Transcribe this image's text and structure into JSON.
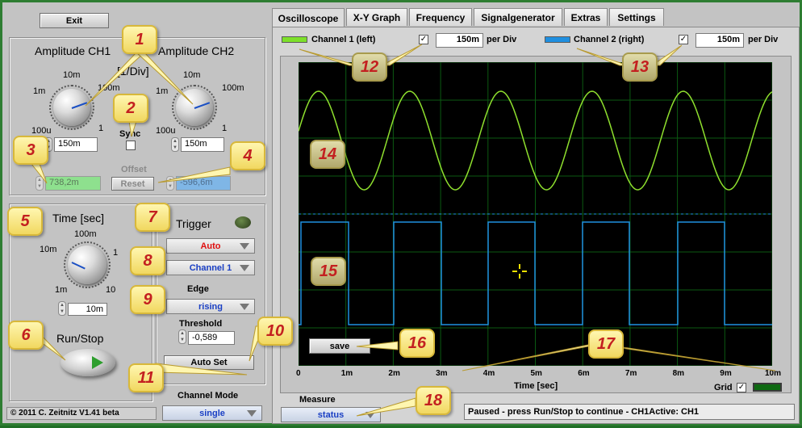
{
  "app": {
    "exit_label": "Exit",
    "copyright": "© 2011  C. Zeitnitz V1.41 beta"
  },
  "amplitude": {
    "ch1_title": "Amplitude CH1",
    "ch2_title": "Amplitude CH2",
    "unit": "[1/Div]",
    "knob_labels": {
      "a": "10m",
      "b": "100m",
      "c": "1m",
      "d": "1",
      "e": "100u"
    },
    "ch1_value": "150m",
    "ch2_value": "150m",
    "sync_label": "Sync",
    "offset_label": "Offset",
    "offset_ch1": "738,2m",
    "offset_ch2": "-596,6m",
    "reset_label": "Reset"
  },
  "time": {
    "title": "Time [sec]",
    "labels": {
      "top": "100m",
      "left_top": "10m",
      "right_top": "1",
      "left_bot": "1m",
      "right_bot": "10"
    },
    "value": "10m"
  },
  "runstop": {
    "label": "Run/Stop"
  },
  "trigger": {
    "title": "Trigger",
    "mode": "Auto",
    "channel": "Channel 1",
    "edge_label": "Edge",
    "edge": "rising",
    "threshold_label": "Threshold",
    "threshold": "-0,589",
    "autoset_label": "Auto Set"
  },
  "channel_mode": {
    "label": "Channel Mode",
    "value": "single"
  },
  "tabs": [
    "Oscilloscope",
    "X-Y Graph",
    "Frequency",
    "Signalgenerator",
    "Extras",
    "Settings"
  ],
  "scope": {
    "ch1_label": "Channel 1 (left)",
    "ch2_label": "Channel 2 (right)",
    "ch1_div": "150m",
    "ch2_div": "150m",
    "per_div": "per Div",
    "save_label": "save",
    "x_ticks": [
      "0",
      "1m",
      "2m",
      "3m",
      "4m",
      "5m",
      "6m",
      "7m",
      "8m",
      "9m",
      "10m"
    ],
    "x_label": "Time [sec]",
    "grid_label": "Grid",
    "colors": {
      "ch1": "#8fe02e",
      "ch2": "#1f8fe0",
      "grid": "#0b5a12",
      "screen": "#000000"
    }
  },
  "measure": {
    "label": "Measure",
    "value": "status"
  },
  "status_text": "Paused - press Run/Stop to continue - CH1Active: CH1",
  "callouts": [
    "1",
    "2",
    "3",
    "4",
    "5",
    "6",
    "7",
    "8",
    "9",
    "10",
    "11",
    "12",
    "13",
    "14",
    "15",
    "16",
    "17",
    "18"
  ]
}
